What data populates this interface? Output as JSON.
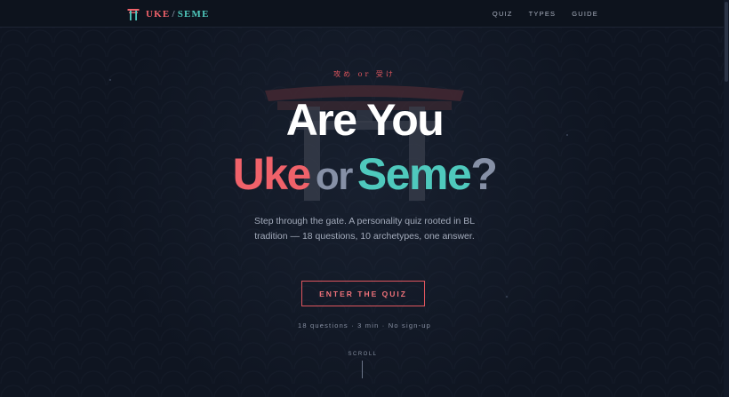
{
  "brand": {
    "uke": "UKE",
    "slash": "/",
    "seme": "SEME",
    "icon": "torii-gate-icon"
  },
  "nav": {
    "items": [
      "QUIZ",
      "TYPES",
      "GUIDE"
    ]
  },
  "hero": {
    "kana": "攻め or 受け",
    "headline_line1": "Are You",
    "headline_uke": "Uke",
    "headline_or": "or",
    "headline_seme": "Seme",
    "headline_qmark": "?",
    "description": "Step through the gate. A personality quiz rooted in BL tradition — 18 questions, 10 archetypes, one answer.",
    "cta_label": "ENTER THE QUIZ",
    "meta": "18 questions · 3 min · No sign-up",
    "scroll_label": "SCROLL"
  },
  "colors": {
    "background": "#0f1521",
    "uke": "#f0626a",
    "seme": "#4fc9bd",
    "muted": "#8690a6"
  }
}
